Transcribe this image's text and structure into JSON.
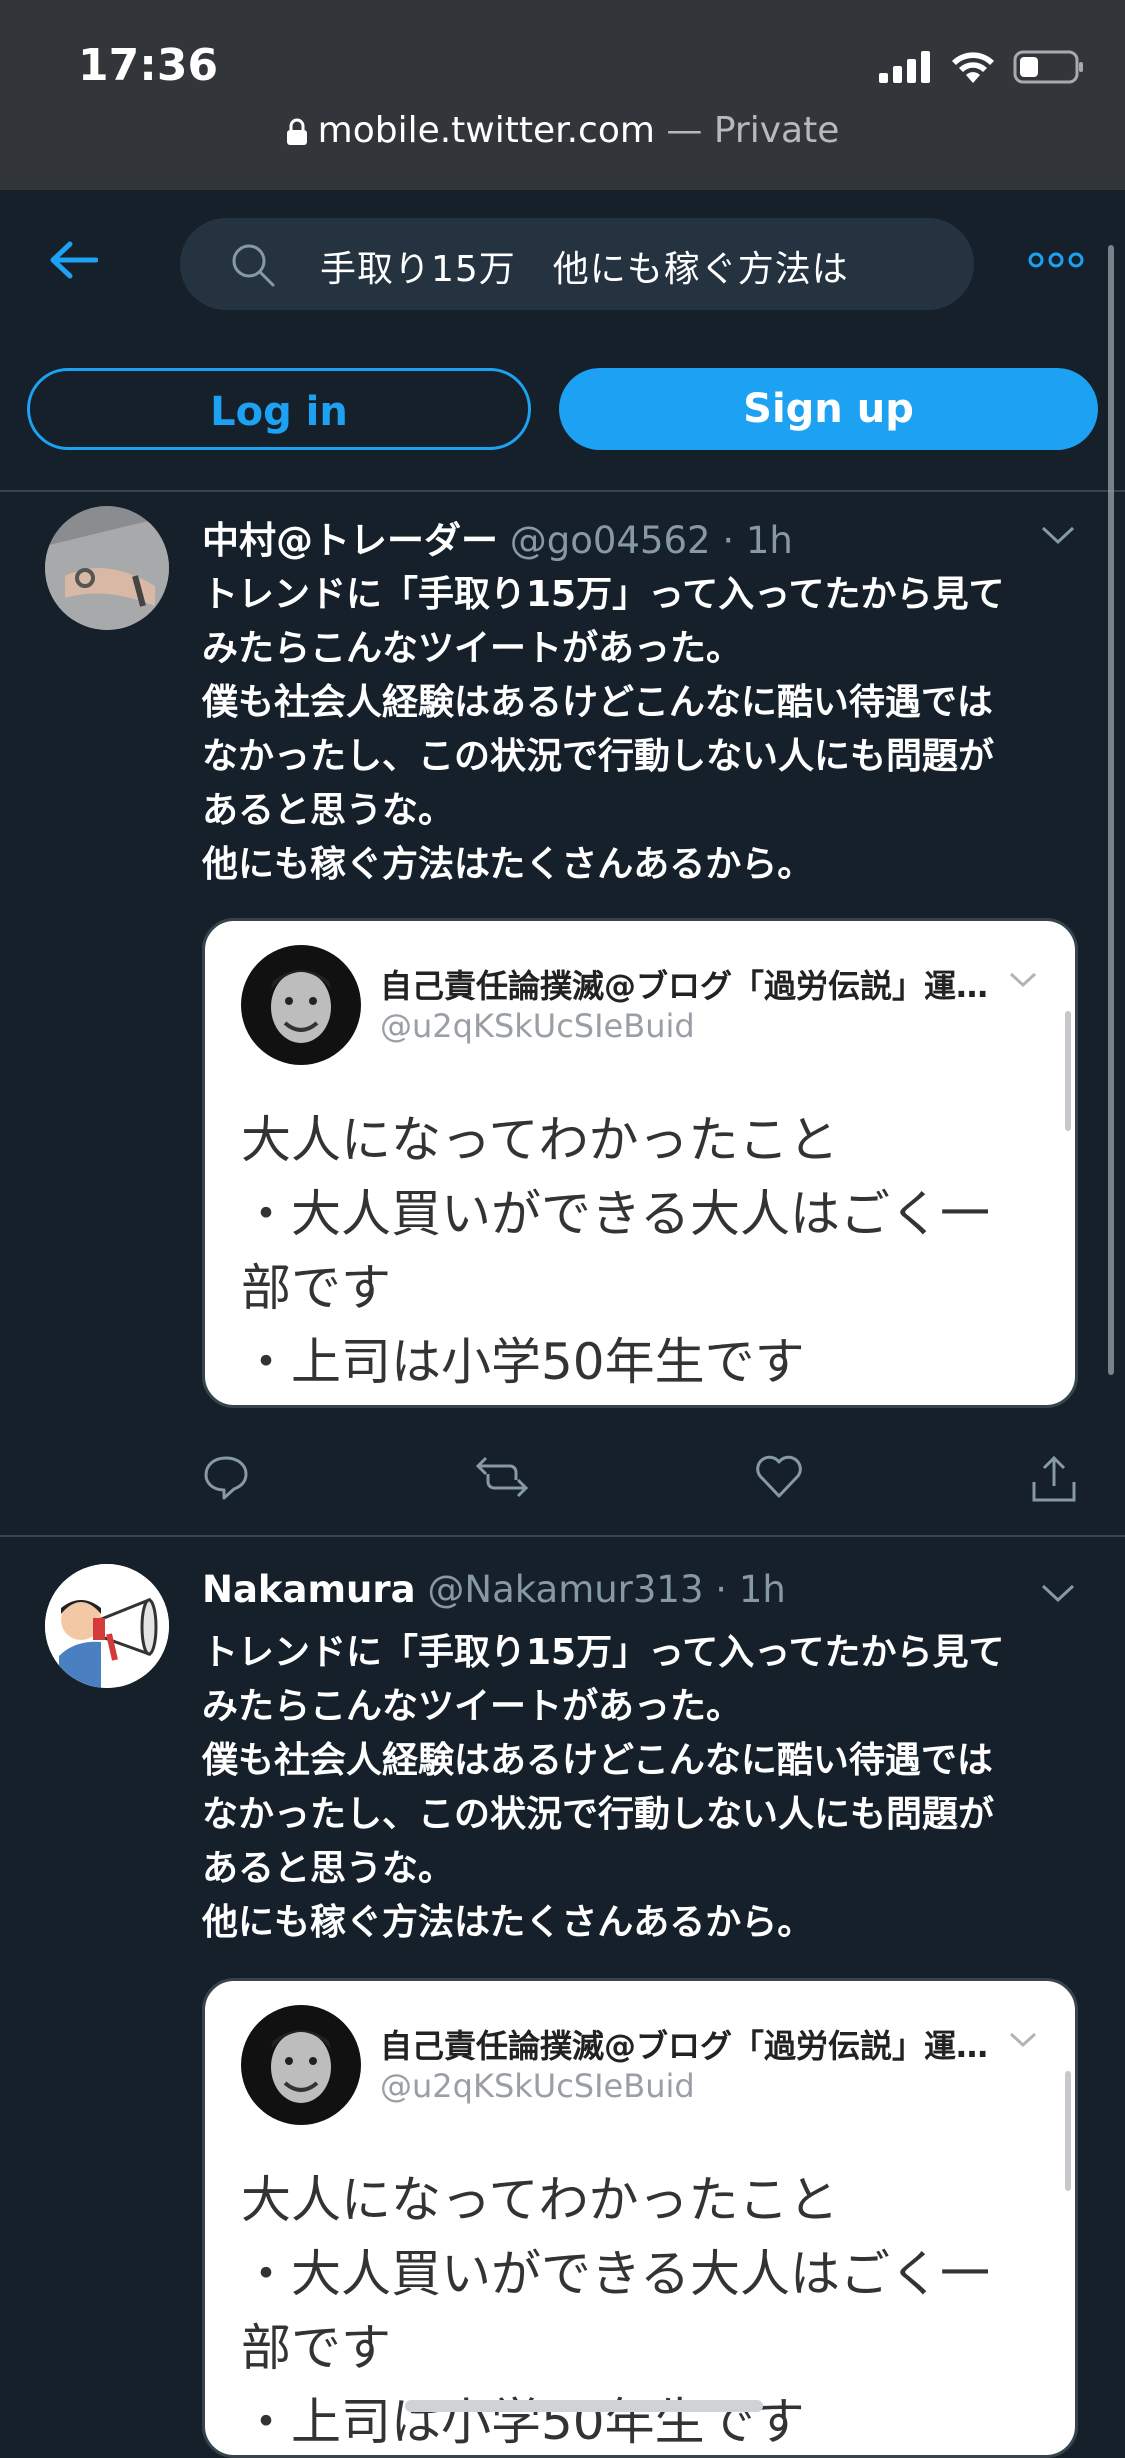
{
  "status": {
    "time": "17:36"
  },
  "browser": {
    "url": "mobile.twitter.com",
    "separator": " — ",
    "mode": "Private"
  },
  "header": {
    "search_query": "手取り15万　他にも稼ぐ方法は",
    "login_label": "Log in",
    "signup_label": "Sign up"
  },
  "tweets": [
    {
      "name": "中村@トレーダー",
      "handle": "@go04562",
      "time": "· 1h",
      "text": "トレンドに「手取り15万」って入ってたから見て\nみたらこんなツイートがあった。\n僕も社会人経験はあるけどこんなに酷い待遇では\nなかったし、この状況で行動しない人にも問題が\nあると思うな。\n他にも稼ぐ方法はたくさんあるから。",
      "quote": {
        "name": "自己責任論撲滅@ブログ「過労伝説」運…",
        "handle": "@u2qKSkUcSIeBuid",
        "text": "大人になってわかったこと\n・大人買いができる大人はごく一\n部です\n・上司は小学50年生です"
      }
    },
    {
      "name": "Nakamura",
      "handle": "@Nakamur313",
      "time": "· 1h",
      "text": "トレンドに「手取り15万」って入ってたから見て\nみたらこんなツイートがあった。\n僕も社会人経験はあるけどこんなに酷い待遇では\nなかったし、この状況で行動しない人にも問題が\nあると思うな。\n他にも稼ぐ方法はたくさんあるから。",
      "quote": {
        "name": "自己責任論撲滅@ブログ「過労伝説」運…",
        "handle": "@u2qKSkUcSIeBuid",
        "text": "大人になってわかったこと\n・大人買いができる大人はごく一\n部です\n・上司は小学50年生です"
      }
    }
  ],
  "colors": {
    "background": "#15202b",
    "accent": "#1da1f2",
    "secondary_text": "#8899a6",
    "border": "#38444d"
  }
}
